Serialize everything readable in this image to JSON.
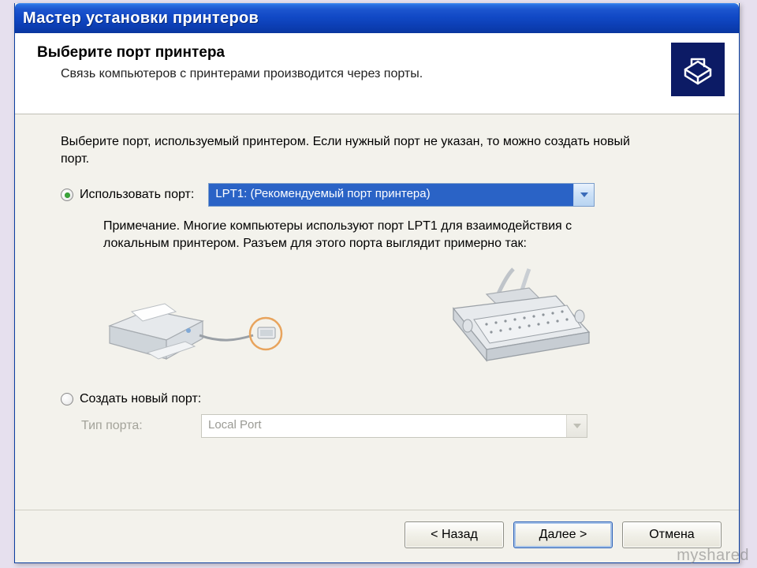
{
  "titlebar": {
    "title": "Мастер установки принтеров"
  },
  "header": {
    "title": "Выберите порт принтера",
    "subtitle": "Связь компьютеров с принтерами производится через порты."
  },
  "body": {
    "instruction": "Выберите порт, используемый принтером. Если нужный порт не указан, то можно создать новый порт.",
    "use_port_label": "Использовать порт:",
    "use_port_value": "LPT1: (Рекомендуемый порт принтера)",
    "note": "Примечание. Многие компьютеры используют порт LPT1 для взаимодействия с локальным принтером. Разъем для этого порта выглядит примерно так:",
    "create_port_label": "Создать новый порт:",
    "port_type_label": "Тип порта:",
    "port_type_value": "Local Port"
  },
  "buttons": {
    "back": "< Назад",
    "next": "Далее >",
    "cancel": "Отмена"
  },
  "watermark": "myshared"
}
